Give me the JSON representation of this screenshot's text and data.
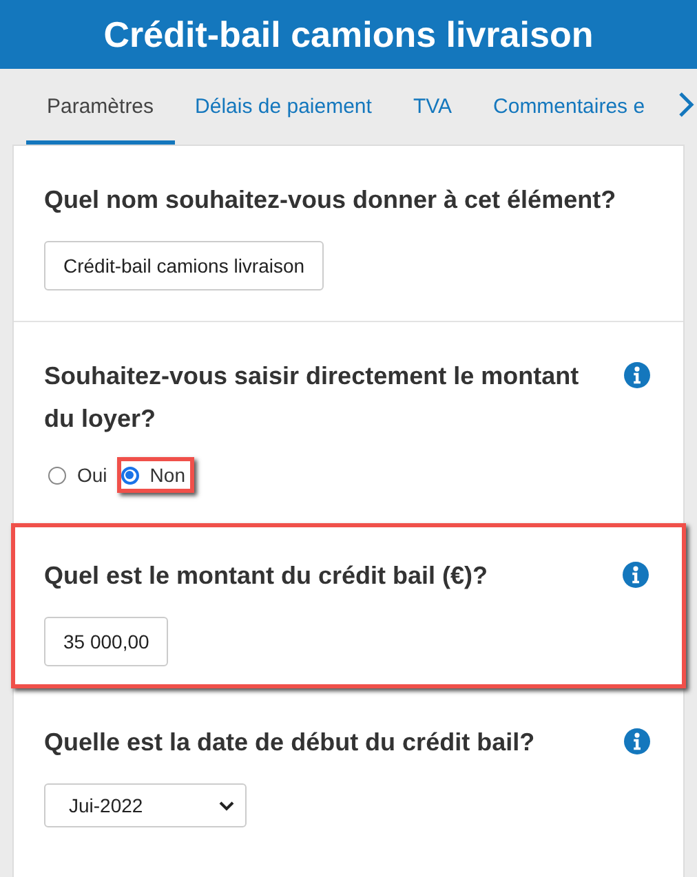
{
  "header": {
    "title": "Crédit-bail camions livraison"
  },
  "tabs": [
    {
      "label": "Paramètres",
      "selected": true
    },
    {
      "label": "Délais de paiement",
      "selected": false
    },
    {
      "label": "TVA",
      "selected": false
    },
    {
      "label": "Commentaires e",
      "selected": false
    }
  ],
  "sections": [
    {
      "kind": "text",
      "question": "Quel nom souhaitez-vous donner à cet élément?",
      "info": false,
      "highlighted": false,
      "value": "Crédit-bail camions livraison"
    },
    {
      "kind": "radio",
      "question": "Souhaitez-vous saisir directement le montant du loyer?",
      "info": true,
      "highlighted": false,
      "options": [
        {
          "label": "Oui",
          "selected": false,
          "highlighted": false
        },
        {
          "label": "Non",
          "selected": true,
          "highlighted": true
        }
      ]
    },
    {
      "kind": "text",
      "question": "Quel est le montant du crédit bail (€)?",
      "info": true,
      "highlighted": true,
      "value": "35 000,00"
    },
    {
      "kind": "select",
      "question": "Quelle est la date de début du crédit bail?",
      "info": true,
      "highlighted": false,
      "value": "Jui-2022"
    }
  ]
}
